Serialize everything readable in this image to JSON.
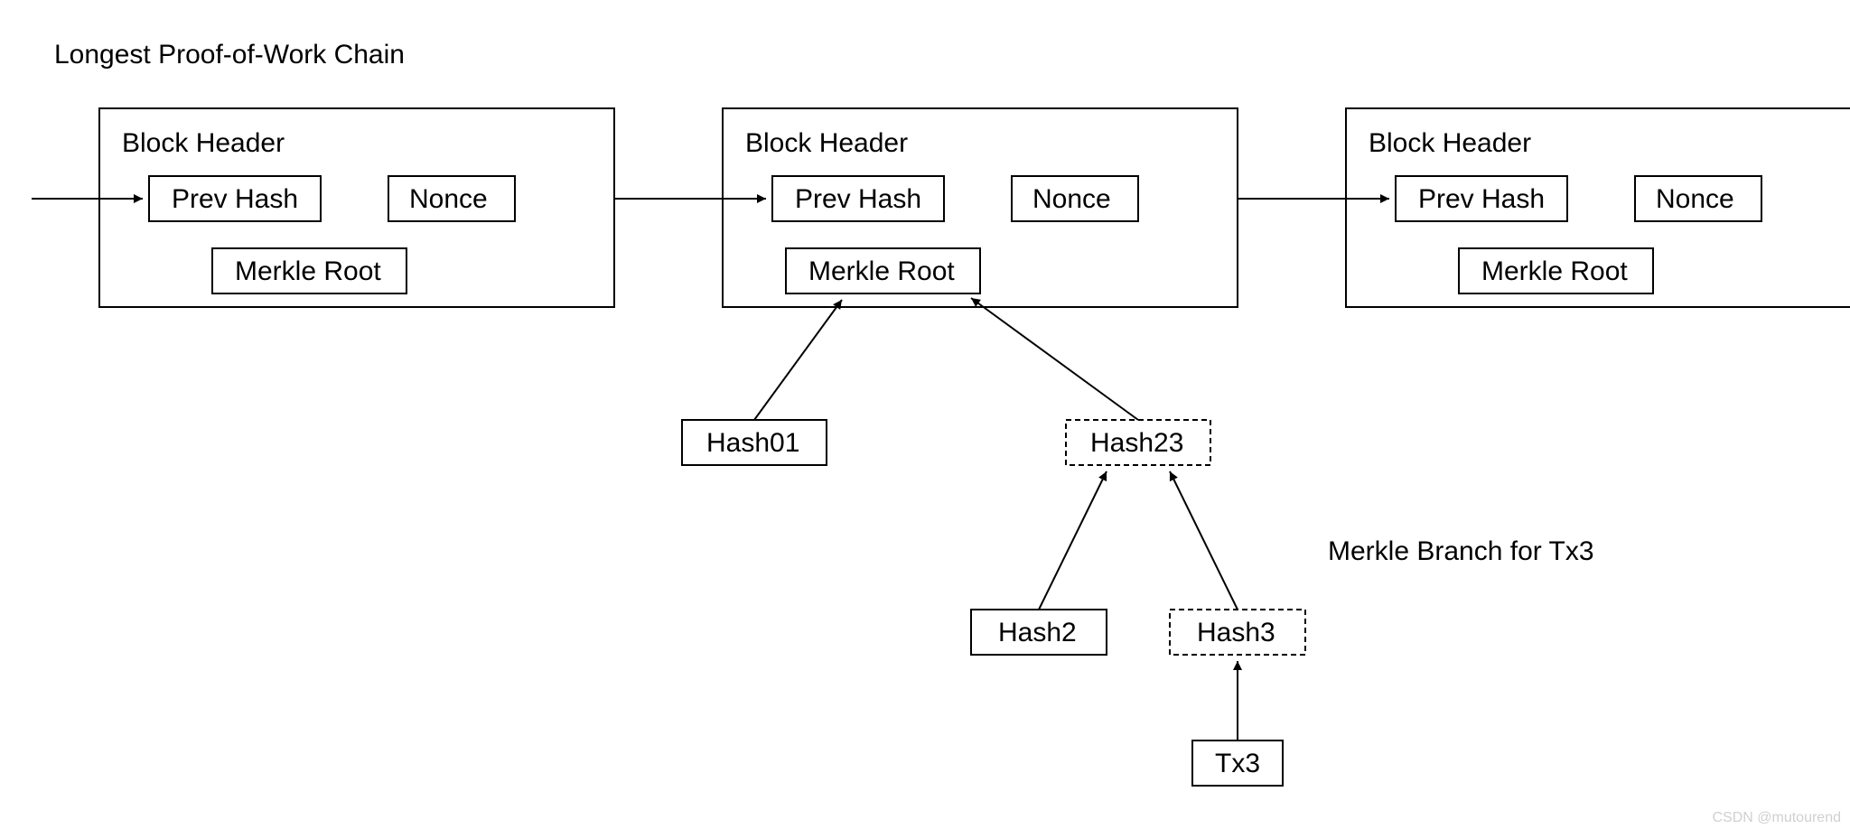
{
  "title": "Longest Proof-of-Work Chain",
  "merkle_branch_label": "Merkle Branch for Tx3",
  "watermark": "CSDN @mutourend",
  "blocks": [
    {
      "header": "Block Header",
      "prev": "Prev Hash",
      "nonce": "Nonce",
      "root": "Merkle Root"
    },
    {
      "header": "Block Header",
      "prev": "Prev Hash",
      "nonce": "Nonce",
      "root": "Merkle Root"
    },
    {
      "header": "Block Header",
      "prev": "Prev Hash",
      "nonce": "Nonce",
      "root": "Merkle Root"
    }
  ],
  "tree": {
    "hash01": "Hash01",
    "hash23": "Hash23",
    "hash2": "Hash2",
    "hash3": "Hash3",
    "tx3": "Tx3"
  }
}
